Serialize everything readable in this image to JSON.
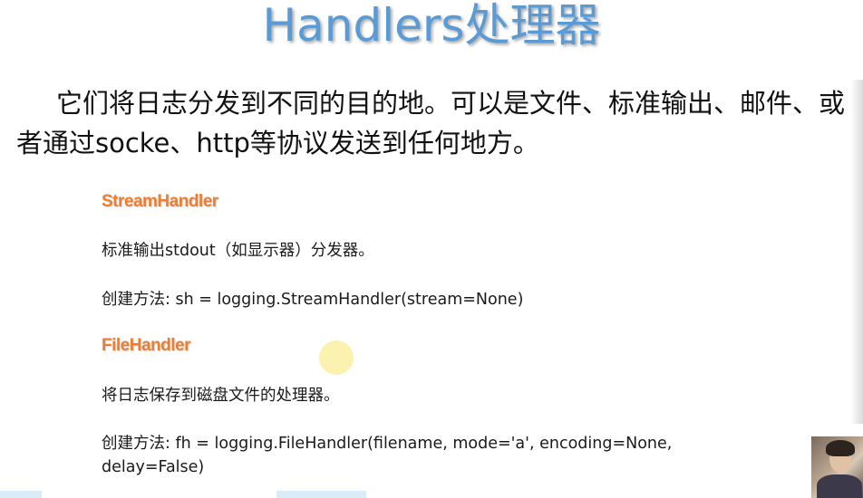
{
  "slide": {
    "title": "Handlers处理器",
    "intro": "它们将日志分发到不同的目的地。可以是文件、标准输出、邮件、或者通过socke、http等协议发送到任何地方。",
    "sections": [
      {
        "heading": "StreamHandler",
        "description": "标准输出stdout（如显示器）分发器。",
        "usage": "创建方法: sh = logging.StreamHandler(stream=None)"
      },
      {
        "heading": "FileHandler",
        "description": "将日志保存到磁盘文件的处理器。",
        "usage": "创建方法: fh = logging.FileHandler(filename, mode='a', encoding=None, delay=False)"
      }
    ]
  },
  "colors": {
    "title": "#5b9bd5",
    "section_heading": "#ed7d31",
    "body_text": "#1a1a1a"
  }
}
